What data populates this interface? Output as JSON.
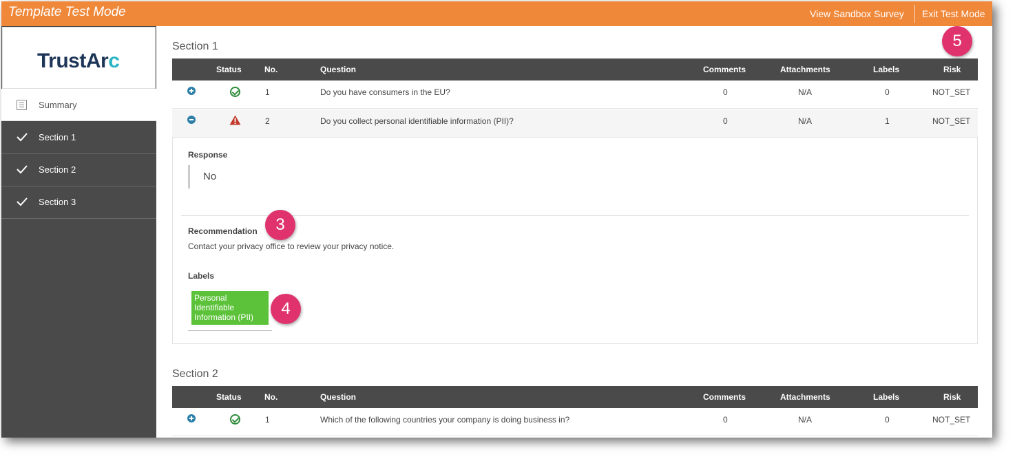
{
  "topbar": {
    "title": "Template Test Mode",
    "view_sandbox": "View Sandbox Survey",
    "exit_test": "Exit Test Mode"
  },
  "sidebar": {
    "logo": {
      "text_main": "TrustAr",
      "text_accent": "c"
    },
    "summary_label": "Summary",
    "sections": [
      {
        "label": "Section 1"
      },
      {
        "label": "Section 2"
      },
      {
        "label": "Section 3"
      }
    ]
  },
  "table_headers": {
    "status": "Status",
    "no": "No.",
    "question": "Question",
    "comments": "Comments",
    "attachments": "Attachments",
    "labels": "Labels",
    "risk": "Risk"
  },
  "sections": [
    {
      "title": "Section 1",
      "rows": [
        {
          "no": "1",
          "question": "Do you have consumers in the EU?",
          "comments": "0",
          "attachments": "N/A",
          "labels": "0",
          "risk": "NOT_SET",
          "status": "ok"
        },
        {
          "no": "2",
          "question": "Do you collect personal identifiable information (PII)?",
          "comments": "0",
          "attachments": "N/A",
          "labels": "1",
          "risk": "NOT_SET",
          "status": "warning"
        }
      ],
      "detail": {
        "response_heading": "Response",
        "response_value": "No",
        "recommendation_heading": "Recommendation",
        "recommendation_text": "Contact your privacy office to review your privacy notice.",
        "labels_heading": "Labels",
        "label_chip": "Personal Identifiable Information (PII)"
      }
    },
    {
      "title": "Section 2",
      "rows": [
        {
          "no": "1",
          "question": "Which of the following countries your company is doing business in?",
          "comments": "0",
          "attachments": "N/A",
          "labels": "0",
          "risk": "NOT_SET",
          "status": "ok"
        }
      ]
    }
  ],
  "callouts": {
    "b3": "3",
    "b4": "4",
    "b5": "5"
  },
  "colors": {
    "topbar": "#f0883a",
    "sidebar": "#4a4a4a",
    "badge": "#e0336d",
    "label_chip": "#5cc23a",
    "status_ok": "#2e8b3a",
    "status_warn": "#c0392b"
  }
}
